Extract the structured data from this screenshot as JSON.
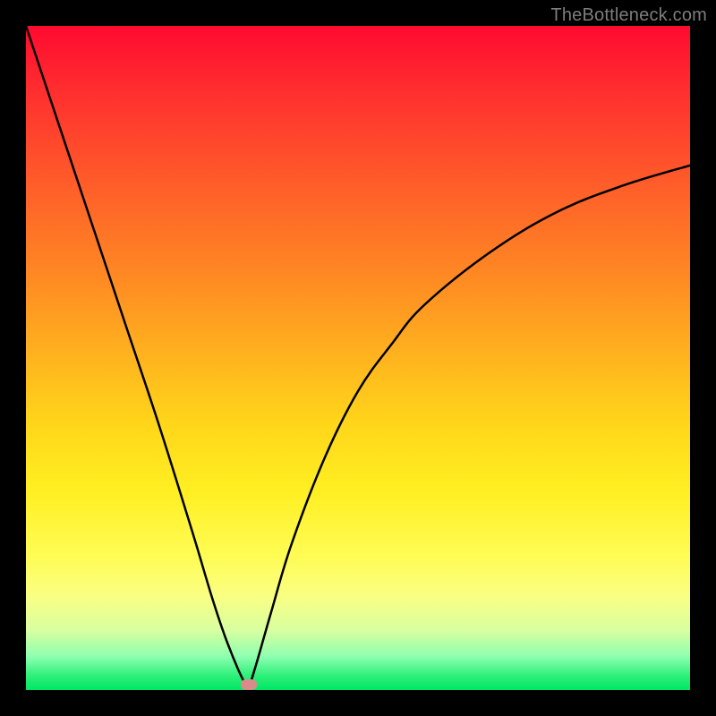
{
  "watermark": "TheBottleneck.com",
  "chart_data": {
    "type": "line",
    "title": "",
    "xlabel": "",
    "ylabel": "",
    "xlim": [
      0,
      100
    ],
    "ylim": [
      0,
      100
    ],
    "background_gradient": {
      "orientation": "vertical",
      "stops": [
        {
          "pos": 0,
          "color": "#ff0a2f"
        },
        {
          "pos": 50,
          "color": "#ffb41e"
        },
        {
          "pos": 80,
          "color": "#fffc55"
        },
        {
          "pos": 100,
          "color": "#00e765"
        }
      ]
    },
    "series": [
      {
        "name": "bottleneck-curve-left",
        "x": [
          0,
          5,
          10,
          15,
          20,
          25,
          28,
          30,
          32,
          33.5
        ],
        "y": [
          100,
          85,
          70,
          55,
          40,
          24,
          14,
          8,
          3,
          0
        ]
      },
      {
        "name": "bottleneck-curve-right",
        "x": [
          33.5,
          35,
          37,
          40,
          45,
          50,
          55,
          60,
          70,
          80,
          90,
          100
        ],
        "y": [
          0,
          5,
          12,
          22,
          35,
          45,
          52,
          58,
          66,
          72,
          76,
          79
        ]
      }
    ],
    "marker": {
      "x": 33.5,
      "y": 0.8,
      "color": "#d98b8b",
      "shape": "pill"
    }
  }
}
